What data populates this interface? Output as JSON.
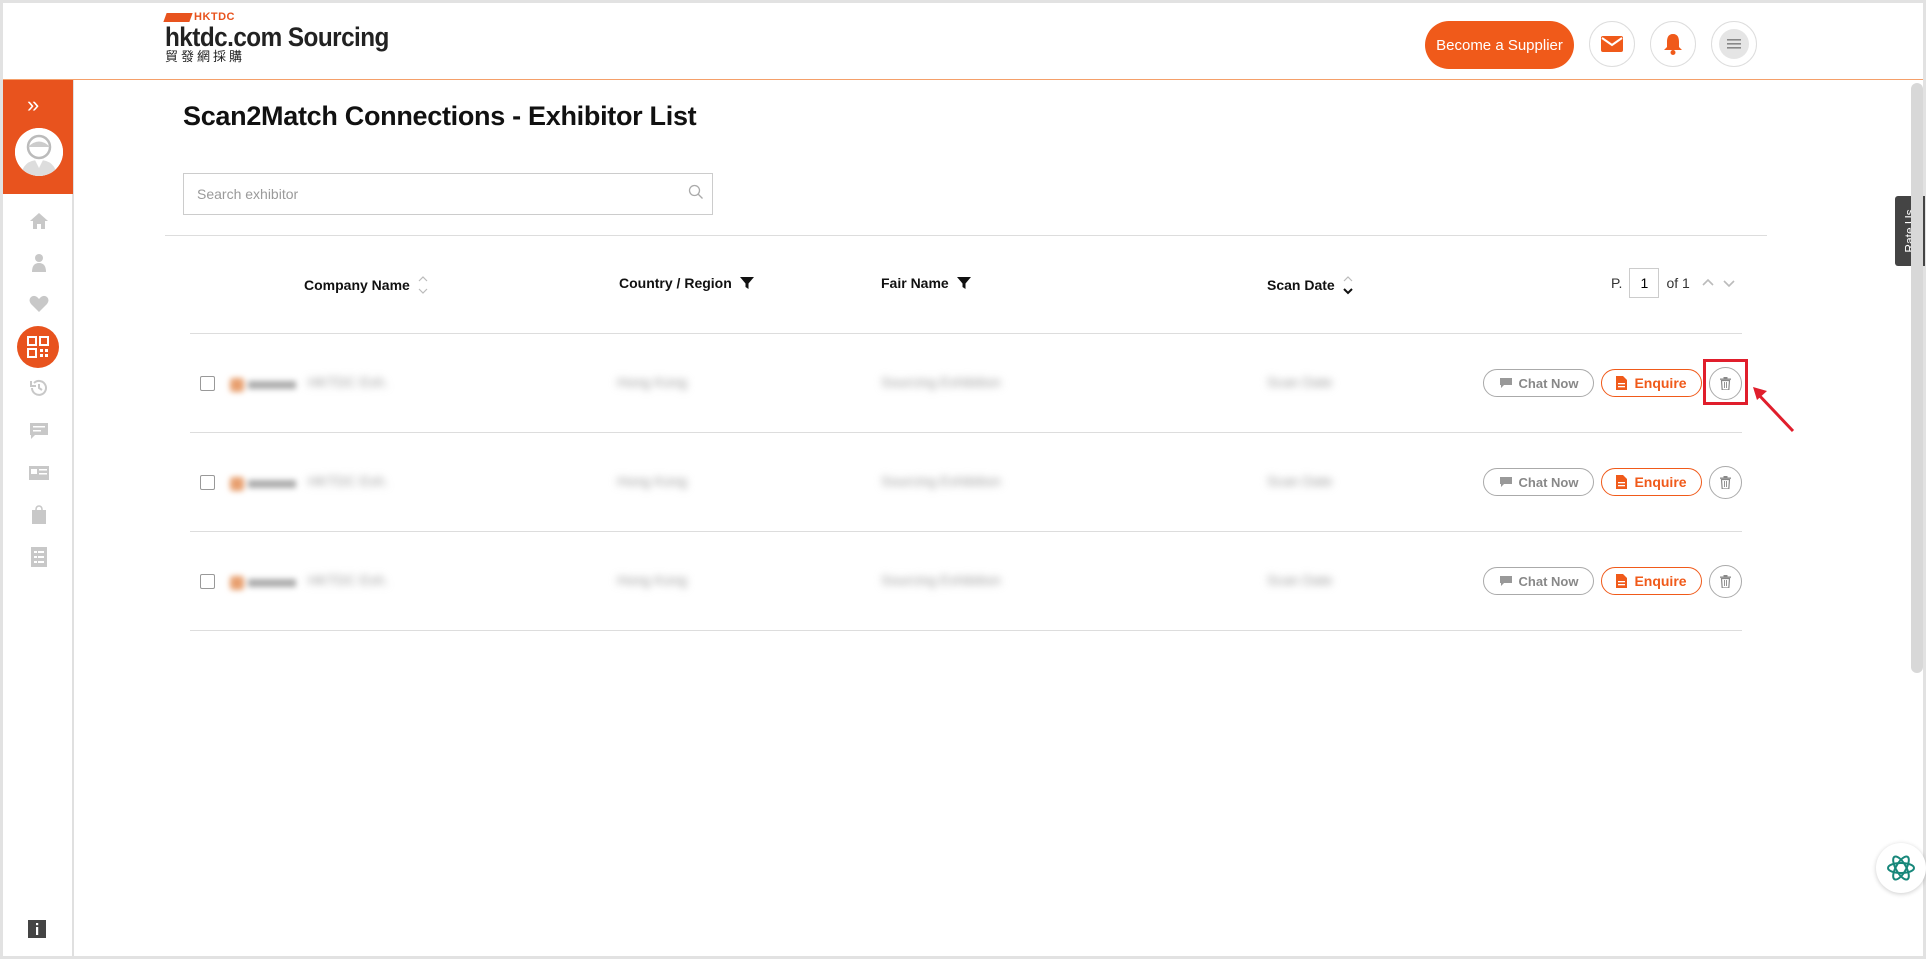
{
  "header": {
    "logo_top": "HKTDC",
    "logo_main": "hktdc.com Sourcing",
    "logo_chinese": "貿發網採購",
    "become_supplier_label": "Become a Supplier"
  },
  "page": {
    "title": "Scan2Match Connections - Exhibitor List"
  },
  "search": {
    "placeholder": "Search exhibitor",
    "value": ""
  },
  "table": {
    "columns": {
      "company_name": "Company Name",
      "country_region": "Country / Region",
      "fair_name": "Fair Name",
      "scan_date": "Scan Date"
    },
    "rows": [
      {
        "company": "HKTDC Exh.",
        "country": "Hong Kong",
        "fair": "Sourcing Exhibition",
        "date": "Scan Date"
      },
      {
        "company": "HKTDC Exh.",
        "country": "Hong Kong",
        "fair": "Sourcing Exhibition",
        "date": "Scan Date"
      },
      {
        "company": "HKTDC Exh.",
        "country": "Hong Kong",
        "fair": "Sourcing Exhibition",
        "date": "Scan Date"
      }
    ],
    "chat_label": "Chat Now",
    "enquire_label": "Enquire"
  },
  "pager": {
    "prefix": "P.",
    "current": "1",
    "of_label": "of 1"
  },
  "rate_us": "Rate Us",
  "colors": {
    "accent": "#f05a1a",
    "sidebar_top": "#e8531e",
    "highlight": "#e01e2c"
  }
}
